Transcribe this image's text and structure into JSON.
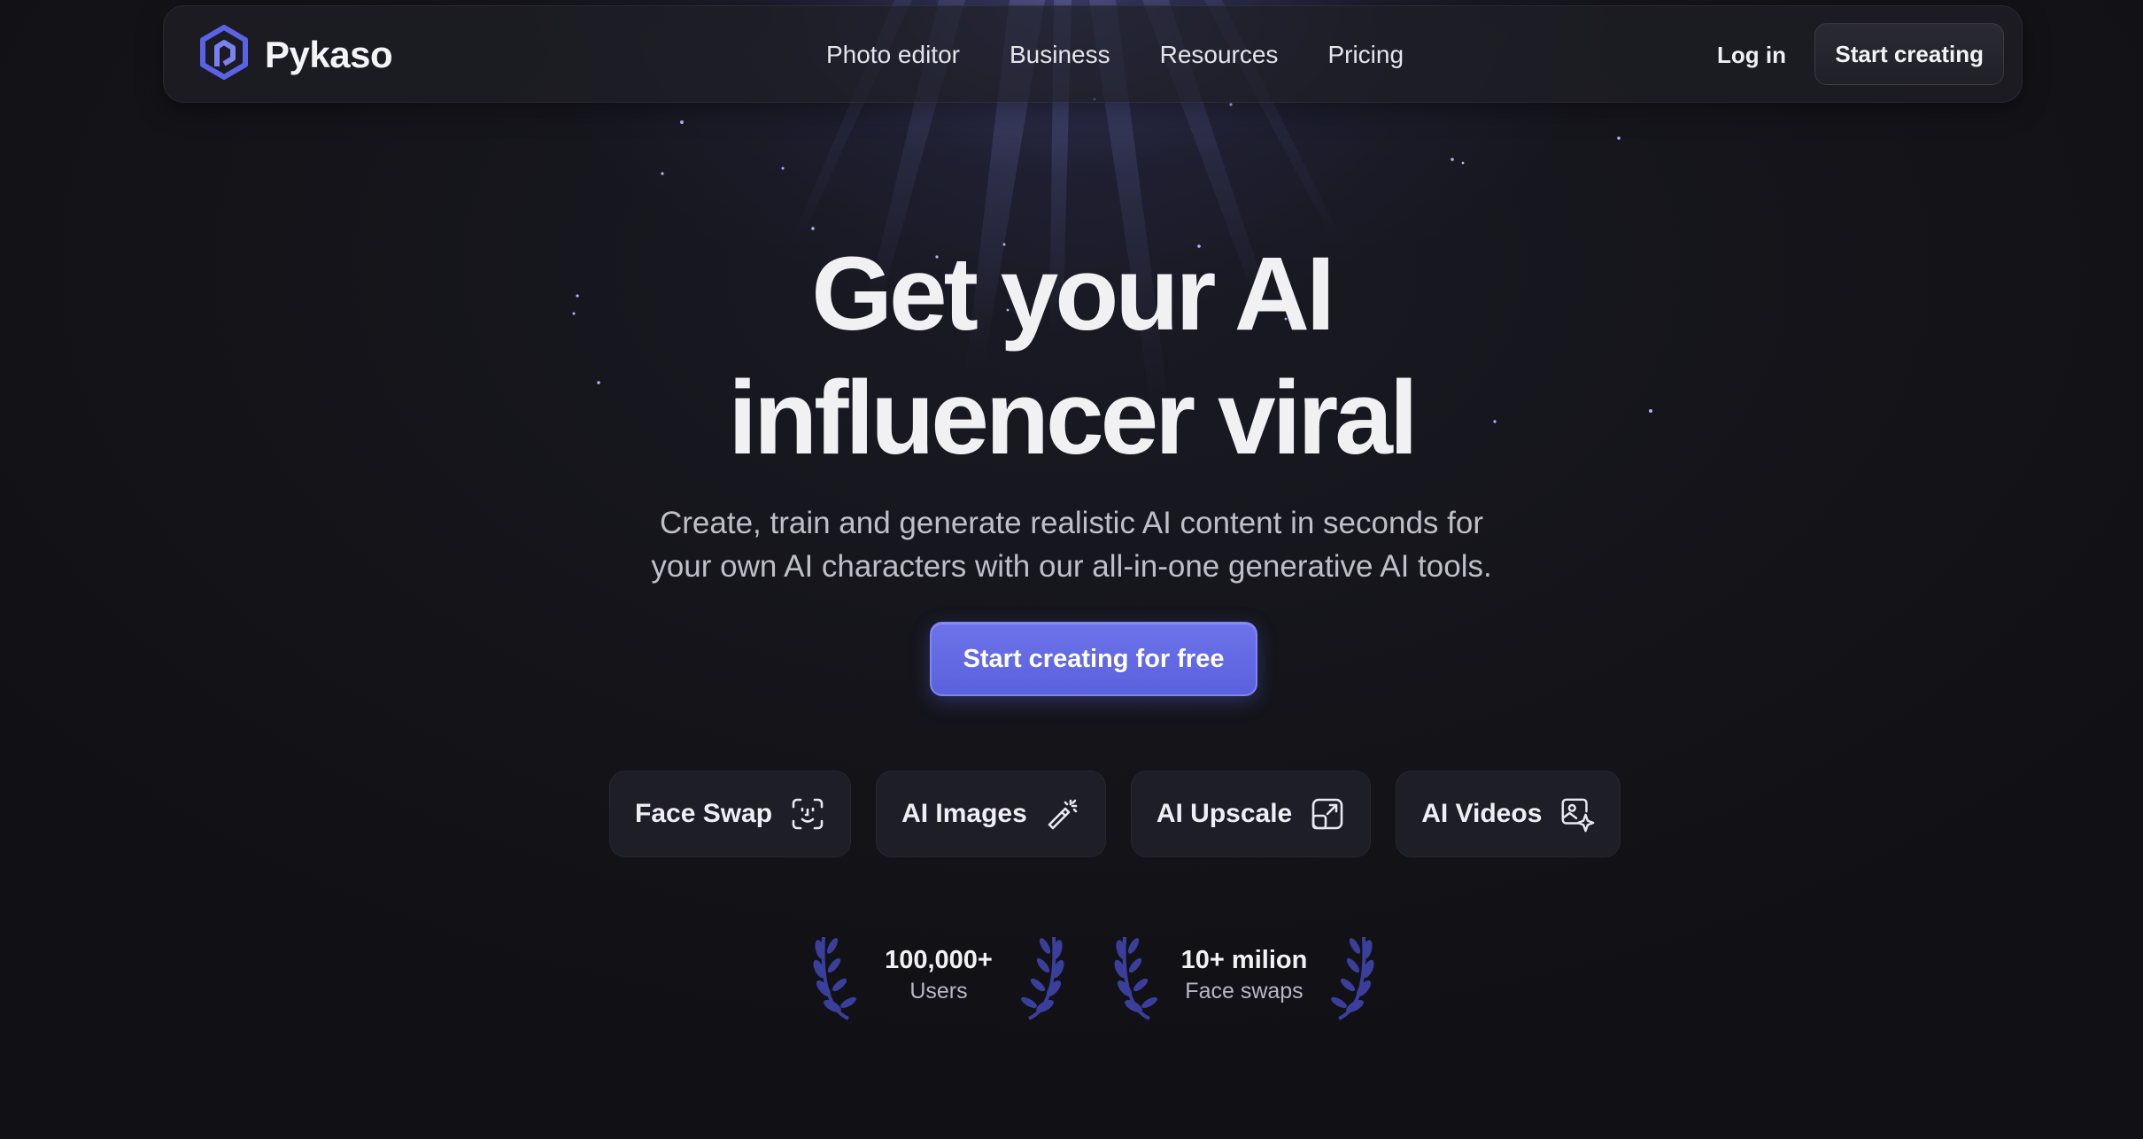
{
  "brand": {
    "name": "Pykaso",
    "logo_icon": "hexagon-logo-icon",
    "accent_color": "#5f66e0"
  },
  "nav": {
    "links": [
      "Photo editor",
      "Business",
      "Resources",
      "Pricing"
    ],
    "login_label": "Log in",
    "cta_label": "Start creating"
  },
  "hero": {
    "title_line1": "Get your AI",
    "title_line2": "influencer viral",
    "subtitle_line1": "Create, train and generate realistic AI content in seconds for",
    "subtitle_line2": "your own AI characters with our all-in-one generative AI tools.",
    "cta_label": "Start creating for free"
  },
  "features": [
    {
      "label": "Face Swap",
      "icon": "face-scan-icon"
    },
    {
      "label": "AI Images",
      "icon": "magic-wand-icon"
    },
    {
      "label": "AI Upscale",
      "icon": "upscale-icon"
    },
    {
      "label": "AI Videos",
      "icon": "image-sparkle-icon"
    }
  ],
  "stats": [
    {
      "value": "100,000+",
      "label": "Users"
    },
    {
      "value": "10+ milion",
      "label": "Face swaps"
    }
  ]
}
